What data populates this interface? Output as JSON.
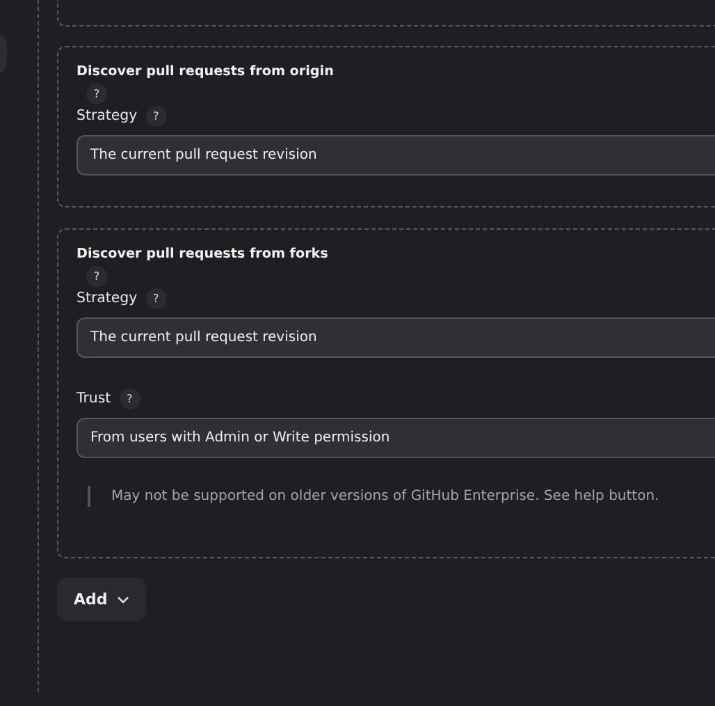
{
  "sections": [
    {
      "title": "Discover pull requests from origin",
      "help": "?",
      "fields": [
        {
          "label": "Strategy",
          "help": "?",
          "value": "The current pull request revision"
        }
      ]
    },
    {
      "title": "Discover pull requests from forks",
      "help": "?",
      "fields": [
        {
          "label": "Strategy",
          "help": "?",
          "value": "The current pull request revision"
        },
        {
          "label": "Trust",
          "help": "?",
          "value": "From users with Admin or Write permission"
        }
      ],
      "note": "May not be supported on older versions of GitHub Enterprise. See help button."
    }
  ],
  "add_button": {
    "label": "Add"
  }
}
